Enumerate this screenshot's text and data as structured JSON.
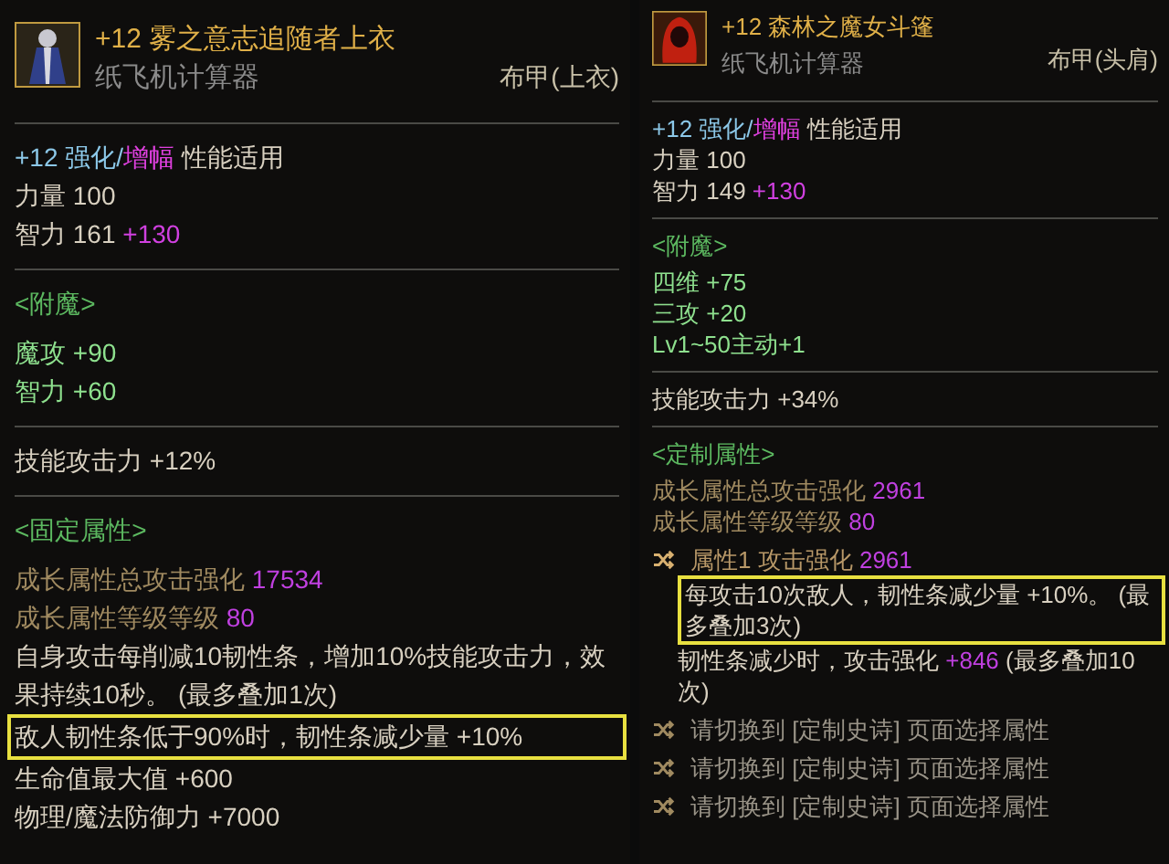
{
  "panels": [
    {
      "header": {
        "name": "+12 雾之意志追随者上衣",
        "source": "纸飞机计算器",
        "type": "布甲(上衣)"
      },
      "sections": [
        [
          {
            "kind": "refine",
            "segments": [
              {
                "kind": "upgrade",
                "text": "+12 强化/"
              },
              {
                "kind": "amp",
                "text": "增幅"
              },
              {
                "kind": "plain",
                "text": " 性能适用"
              }
            ]
          },
          {
            "kind": "stat",
            "label": "力量",
            "value": "100"
          },
          {
            "kind": "stat",
            "label": "智力",
            "value": "161",
            "bonus": "+130"
          }
        ],
        [
          {
            "kind": "heading",
            "text": "<附魔>"
          },
          {
            "kind": "enchant",
            "label": "魔攻",
            "value": "+90"
          },
          {
            "kind": "enchant",
            "label": "智力",
            "value": "+60"
          }
        ],
        [
          {
            "kind": "stat",
            "label": "技能攻击力",
            "value": "+12%"
          }
        ],
        [
          {
            "kind": "heading",
            "text": "<固定属性>"
          },
          {
            "kind": "growth",
            "label": "成长属性总攻击强化",
            "value": "17534"
          },
          {
            "kind": "growth",
            "label": "成长属性等级等级",
            "value": "80"
          },
          {
            "kind": "text",
            "indent": false,
            "highlighted": false,
            "segments": [
              {
                "kind": "plain",
                "text": "自身攻击每削减10韧性条，增加10%技能攻击力，效果持续10秒。 (最多叠加1次)"
              }
            ]
          },
          {
            "kind": "text",
            "indent": false,
            "highlighted": true,
            "segments": [
              {
                "kind": "plain",
                "text": "敌人韧性条低于90%时，韧性条减少量 +10%"
              }
            ]
          },
          {
            "kind": "stat",
            "label": "生命值最大值",
            "value": "+600"
          },
          {
            "kind": "stat",
            "label": "物理/魔法防御力",
            "value": "+7000"
          }
        ]
      ]
    },
    {
      "header": {
        "name": "+12 森林之魔女斗篷",
        "source": "纸飞机计算器",
        "type": "布甲(头肩)"
      },
      "sections": [
        [
          {
            "kind": "refine",
            "segments": [
              {
                "kind": "upgrade",
                "text": "+12 强化/"
              },
              {
                "kind": "amp",
                "text": "增幅"
              },
              {
                "kind": "plain",
                "text": " 性能适用"
              }
            ]
          },
          {
            "kind": "stat",
            "label": "力量",
            "value": "100"
          },
          {
            "kind": "stat",
            "label": "智力",
            "value": "149",
            "bonus": "+130"
          }
        ],
        [
          {
            "kind": "heading",
            "text": "<附魔>"
          },
          {
            "kind": "enchant",
            "label": "四维",
            "value": "+75"
          },
          {
            "kind": "enchant",
            "label": "三攻",
            "value": "+20"
          },
          {
            "kind": "enchant",
            "label": "Lv1~50主动+1"
          }
        ],
        [
          {
            "kind": "stat",
            "label": "技能攻击力",
            "value": "+34%"
          }
        ],
        [
          {
            "kind": "heading",
            "text": "<定制属性>"
          },
          {
            "kind": "growth",
            "label": "成长属性总攻击强化",
            "value": "2961"
          },
          {
            "kind": "growth",
            "label": "成长属性等级等级",
            "value": "80"
          },
          {
            "kind": "option",
            "dim": false,
            "label": "属性1  攻击强化",
            "value": "2961"
          },
          {
            "kind": "text",
            "indent": true,
            "highlighted": true,
            "segments": [
              {
                "kind": "plain",
                "text": "每攻击10次敌人，韧性条减少量 +10%。 (最多叠加3次)"
              }
            ]
          },
          {
            "kind": "text",
            "indent": true,
            "highlighted": false,
            "segments": [
              {
                "kind": "plain",
                "text": "韧性条减少时，攻击强化 "
              },
              {
                "kind": "value",
                "text": "+846"
              },
              {
                "kind": "plain",
                "text": " (最多叠加10次)"
              }
            ]
          },
          {
            "kind": "option",
            "dim": true,
            "label": "请切换到 [定制史诗] 页面选择属性"
          },
          {
            "kind": "option",
            "dim": true,
            "label": "请切换到 [定制史诗] 页面选择属性"
          },
          {
            "kind": "option",
            "dim": true,
            "label": "请切换到 [定制史诗] 页面选择属性"
          }
        ]
      ]
    }
  ]
}
